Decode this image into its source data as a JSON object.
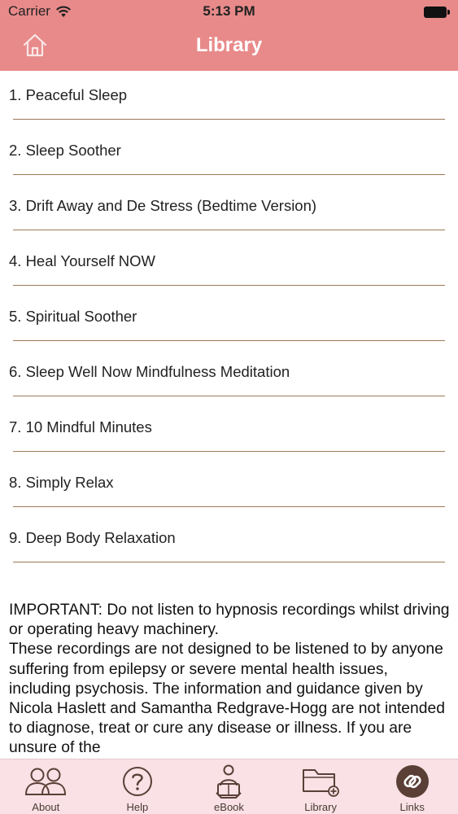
{
  "status_bar": {
    "carrier": "Carrier",
    "time": "5:13 PM"
  },
  "nav_bar": {
    "title": "Library",
    "home_icon": "home-icon"
  },
  "library": {
    "items": [
      {
        "label": "1. Peaceful Sleep"
      },
      {
        "label": "2. Sleep Soother"
      },
      {
        "label": "3. Drift Away and De Stress (Bedtime Version)"
      },
      {
        "label": "4. Heal Yourself NOW"
      },
      {
        "label": "5. Spiritual Soother"
      },
      {
        "label": "6. Sleep Well Now Mindfulness Meditation"
      },
      {
        "label": "7. 10 Mindful Minutes"
      },
      {
        "label": "8. Simply Relax"
      },
      {
        "label": "9. Deep Body Relaxation"
      }
    ]
  },
  "disclaimer": {
    "line1": "IMPORTANT: Do not listen to hypnosis recordings whilst driving or operating heavy machinery.",
    "line2": "These recordings are not designed to be listened to by anyone suffering from epilepsy or severe mental health issues, including psychosis. The information and guidance given by Nicola Haslett and Samantha Redgrave-Hogg are not intended to diagnose, treat or cure any disease or illness. If you are unsure of the"
  },
  "tab_bar": {
    "tabs": [
      {
        "label": "About",
        "icon": "people-icon"
      },
      {
        "label": "Help",
        "icon": "question-icon"
      },
      {
        "label": "eBook",
        "icon": "reader-icon"
      },
      {
        "label": "Library",
        "icon": "folder-add-icon"
      },
      {
        "label": "Links",
        "icon": "link-icon",
        "selected": true
      }
    ]
  },
  "colors": {
    "header": "#e88a8a",
    "divider": "#9c7a57",
    "tab_bar": "#f9e1e5",
    "tab_icon": "#5a3f36"
  }
}
